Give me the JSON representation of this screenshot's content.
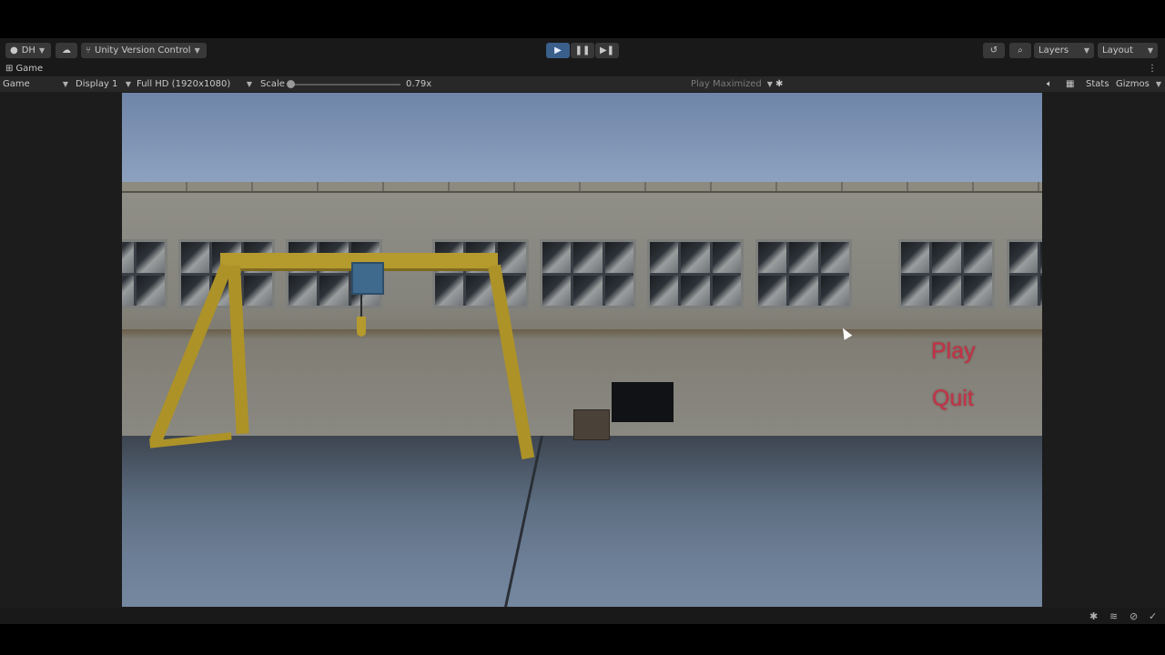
{
  "toolbar": {
    "account_label": "DH",
    "account_icon": "account-icon",
    "cloud_icon": "cloud-icon",
    "version_control_label": "Unity Version Control",
    "version_control_icon": "version-control-icon",
    "play_icon": "play-icon",
    "pause_icon": "pause-icon",
    "step_icon": "step-icon",
    "history_icon": "history-icon",
    "search_icon": "search-icon",
    "layers_label": "Layers",
    "layout_label": "Layout"
  },
  "tab": {
    "icon": "gamepad-icon",
    "label": "Game"
  },
  "game_controls": {
    "view_mode": "Game",
    "display": "Display 1",
    "resolution": "Full HD (1920x1080)",
    "scale_label": "Scale",
    "scale_value": "0.79x",
    "play_mode": "Play Maximized",
    "bug_icon": "bug-icon",
    "audio_icon": "speaker-icon",
    "stats_icon": "grid-icon",
    "stats_label": "Stats",
    "gizmos_label": "Gizmos"
  },
  "game_menu": {
    "play_label": "Play",
    "quit_label": "Quit",
    "menu_color": "#c23247"
  },
  "status_bar": {
    "icons": [
      "bug-icon",
      "layers-icon",
      "debug-icon",
      "check-circle-icon"
    ]
  }
}
